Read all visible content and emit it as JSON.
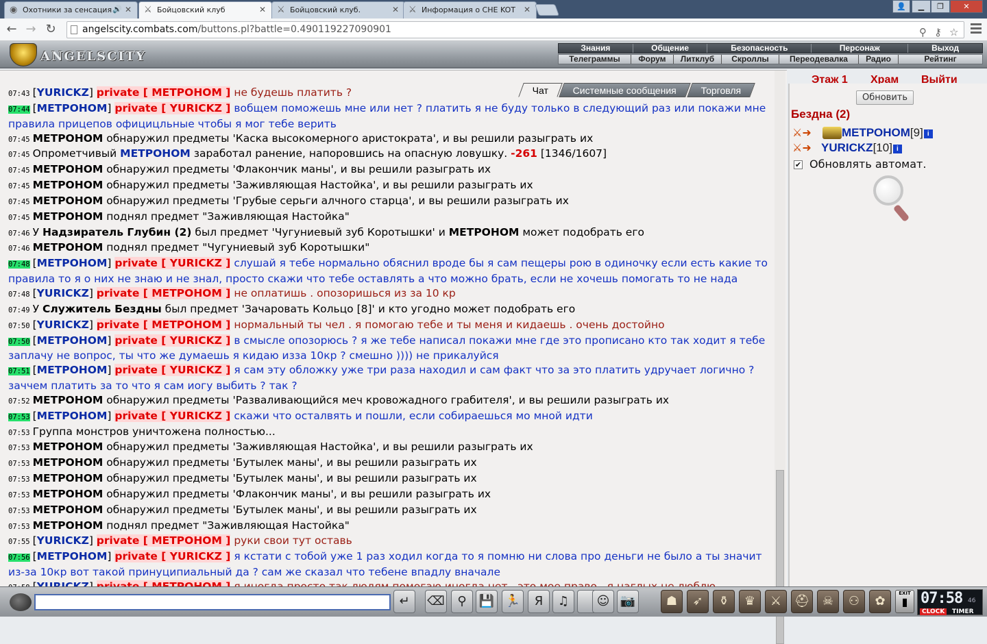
{
  "browser": {
    "tabs": [
      {
        "title": "Охотники за сенсация",
        "active": false,
        "audio": true
      },
      {
        "title": "Бойцовский клуб",
        "active": true,
        "audio": false
      },
      {
        "title": "Бойцовский клуб.",
        "active": false,
        "audio": false
      },
      {
        "title": "Информация о CHE KOT",
        "active": false,
        "audio": false
      }
    ],
    "url_host": "angelscity.combats.com",
    "url_path": "/buttons.pl?battle=0.490119227090901"
  },
  "game": {
    "logo_text": "ANGELSCITY",
    "menu_primary": [
      "Знания",
      "Общение",
      "Безопасность",
      "Персонаж",
      "Выход"
    ],
    "menu_secondary": [
      "Телеграммы",
      "Форум",
      "Литклуб",
      "Скроллы",
      "Переодевалка",
      "Радио",
      "Рейтинг"
    ],
    "cut_text": [
      "Этаж 1",
      "Храм",
      "Выйти"
    ]
  },
  "chat": {
    "tabs": [
      "Чат",
      "Системные сообщения",
      "Торговля"
    ],
    "messages": [
      {
        "time": "07:43",
        "hl": false,
        "kind": "private",
        "from": "YURICKZ",
        "to": "МЕТРОНОМ",
        "text": "не будешь платить ?",
        "color": "red"
      },
      {
        "time": "07:44",
        "hl": true,
        "kind": "private",
        "from": "МЕТРОНОМ",
        "to": "YURICKZ",
        "text": "вобщем поможешь мне или нет ? платить я не буду только в следующий раз или покажи мне правила прицепов официцльные чтобы я мог тебе верить",
        "color": "blue"
      },
      {
        "time": "07:45",
        "kind": "sys",
        "parts": [
          {
            "b": "МЕТРОНОМ"
          },
          {
            "t": " обнаружил предметы 'Каска высокомерного аристократа', и вы решили разыграть их"
          }
        ]
      },
      {
        "time": "07:45",
        "kind": "sys",
        "parts": [
          {
            "t": "Опрометчивый "
          },
          {
            "bb": "МЕТРОНОМ"
          },
          {
            "t": " заработал ранение, напоровшись на опасную ловушку. "
          },
          {
            "dmg": "-261"
          },
          {
            "t": " [1346/1607]"
          }
        ]
      },
      {
        "time": "07:45",
        "kind": "sys",
        "parts": [
          {
            "b": "МЕТРОНОМ"
          },
          {
            "t": " обнаружил предметы 'Флакончик маны', и вы решили разыграть их"
          }
        ]
      },
      {
        "time": "07:45",
        "kind": "sys",
        "parts": [
          {
            "b": "МЕТРОНОМ"
          },
          {
            "t": " обнаружил предметы 'Заживляющая Настойка', и вы решили разыграть их"
          }
        ]
      },
      {
        "time": "07:45",
        "kind": "sys",
        "parts": [
          {
            "b": "МЕТРОНОМ"
          },
          {
            "t": " обнаружил предметы 'Грубые серьги алчного старца', и вы решили разыграть их"
          }
        ]
      },
      {
        "time": "07:45",
        "kind": "sys",
        "parts": [
          {
            "b": "МЕТРОНОМ"
          },
          {
            "t": " поднял предмет \"Заживляющая Настойка\""
          }
        ]
      },
      {
        "time": "07:46",
        "kind": "sys",
        "parts": [
          {
            "t": "У "
          },
          {
            "b": "Надзиратель Глубин (2)"
          },
          {
            "t": " был предмет 'Чугуниевый зуб Коротышки' и "
          },
          {
            "b": "МЕТРОНОМ"
          },
          {
            "t": " может подобрать его"
          }
        ]
      },
      {
        "time": "07:46",
        "kind": "sys",
        "parts": [
          {
            "b": "МЕТРОНОМ"
          },
          {
            "t": " поднял предмет \"Чугуниевый зуб Коротышки\""
          }
        ]
      },
      {
        "time": "07:48",
        "hl": true,
        "kind": "private",
        "from": "МЕТРОНОМ",
        "to": "YURICKZ",
        "text": "слушай я тебе нормально обяснил вроде бы я сам пещеры рою в одиночку если есть какие то правила то я о них не знаю и не знал, просто скажи что тебе оставлять а что можно брать, если не хочешь помогать то не нада",
        "color": "blue"
      },
      {
        "time": "07:48",
        "hl": false,
        "kind": "private",
        "from": "YURICKZ",
        "to": "МЕТРОНОМ",
        "text": "не оплатишь . опозоришься из за 10 кр",
        "color": "red"
      },
      {
        "time": "07:49",
        "kind": "sys",
        "parts": [
          {
            "t": "У "
          },
          {
            "b": "Служитель Бездны"
          },
          {
            "t": " был предмет 'Зачаровать Кольцо [8]' и кто угодно может подобрать его"
          }
        ]
      },
      {
        "time": "07:50",
        "hl": false,
        "kind": "private",
        "from": "YURICKZ",
        "to": "МЕТРОНОМ",
        "text": "нормальный ты чел . я помогаю тебе и ты меня и кидаешь . очень достойно",
        "color": "red"
      },
      {
        "time": "07:50",
        "hl": true,
        "kind": "private",
        "from": "МЕТРОНОМ",
        "to": "YURICKZ",
        "text": "в смысле опозорюсь ? я же тебе написал покажи мне где это прописано кто так ходит я тебе заплачу не вопрос, ты что же думаешь я кидаю изза 10кр ? смешно )))) не прикалуйся",
        "color": "blue"
      },
      {
        "time": "07:51",
        "hl": true,
        "kind": "private",
        "from": "МЕТРОНОМ",
        "to": "YURICKZ",
        "text": "я сам эту обложку уже три раза находил и сам факт что за это платить удручает логично ? заччем платить за то что я сам иогу выбить ? так ?",
        "color": "blue"
      },
      {
        "time": "07:52",
        "kind": "sys",
        "parts": [
          {
            "b": "МЕТРОНОМ"
          },
          {
            "t": " обнаружил предметы 'Разваливающийся меч кровожадного грабителя', и вы решили разыграть их"
          }
        ]
      },
      {
        "time": "07:53",
        "hl": true,
        "kind": "private",
        "from": "МЕТРОНОМ",
        "to": "YURICKZ",
        "text": "скажи что осталвять и пошли, если собираешься мо мной идти",
        "color": "blue"
      },
      {
        "time": "07:53",
        "kind": "sys",
        "parts": [
          {
            "t": "Группа монстров уничтожена полностью..."
          }
        ]
      },
      {
        "time": "07:53",
        "kind": "sys",
        "parts": [
          {
            "b": "МЕТРОНОМ"
          },
          {
            "t": " обнаружил предметы 'Заживляющая Настойка', и вы решили разыграть их"
          }
        ]
      },
      {
        "time": "07:53",
        "kind": "sys",
        "parts": [
          {
            "b": "МЕТРОНОМ"
          },
          {
            "t": " обнаружил предметы 'Бутылек маны', и вы решили разыграть их"
          }
        ]
      },
      {
        "time": "07:53",
        "kind": "sys",
        "parts": [
          {
            "b": "МЕТРОНОМ"
          },
          {
            "t": " обнаружил предметы 'Бутылек маны', и вы решили разыграть их"
          }
        ]
      },
      {
        "time": "07:53",
        "kind": "sys",
        "parts": [
          {
            "b": "МЕТРОНОМ"
          },
          {
            "t": " обнаружил предметы 'Флакончик маны', и вы решили разыграть их"
          }
        ]
      },
      {
        "time": "07:53",
        "kind": "sys",
        "parts": [
          {
            "b": "МЕТРОНОМ"
          },
          {
            "t": " обнаружил предметы 'Бутылек маны', и вы решили разыграть их"
          }
        ]
      },
      {
        "time": "07:53",
        "kind": "sys",
        "parts": [
          {
            "b": "МЕТРОНОМ"
          },
          {
            "t": " поднял предмет \"Заживляющая Настойка\""
          }
        ]
      },
      {
        "time": "07:55",
        "hl": false,
        "kind": "private",
        "from": "YURICKZ",
        "to": "МЕТРОНОМ",
        "text": "руки свои тут оставь",
        "color": "red"
      },
      {
        "time": "07:56",
        "hl": true,
        "kind": "private",
        "from": "МЕТРОНОМ",
        "to": "YURICKZ",
        "text": "я кстати с тобой уже 1 раз ходил когда то я помню ни слова про деньги не было а ты значит из-за 10кр вот такой принуципиальный да ? сам же сказал что тебене впадлу вначале",
        "color": "blue"
      },
      {
        "time": "07:58",
        "hl": false,
        "kind": "private",
        "from": "YURICKZ",
        "to": "МЕТРОНОМ",
        "text": "я иногда просто так людям помогаю иногда нет . это мое право . я наглых не люблю",
        "color": "red"
      }
    ],
    "private_word": "private"
  },
  "panel": {
    "refresh_label": "Обновить",
    "location": "Бездна (2)",
    "players": [
      {
        "name": "МЕТРОНОМ",
        "level": "[9]",
        "clan": true
      },
      {
        "name": "YURICKZ",
        "level": "[10]",
        "clan": false
      }
    ],
    "auto_refresh_label": "Обновлять автомат.",
    "auto_refresh_checked": true
  },
  "bottom": {
    "exit_label": "EXIT",
    "clock_time": "07:58",
    "clock_seconds": "46",
    "clock_label": "CLOCK",
    "timer_label": "TIMER"
  }
}
